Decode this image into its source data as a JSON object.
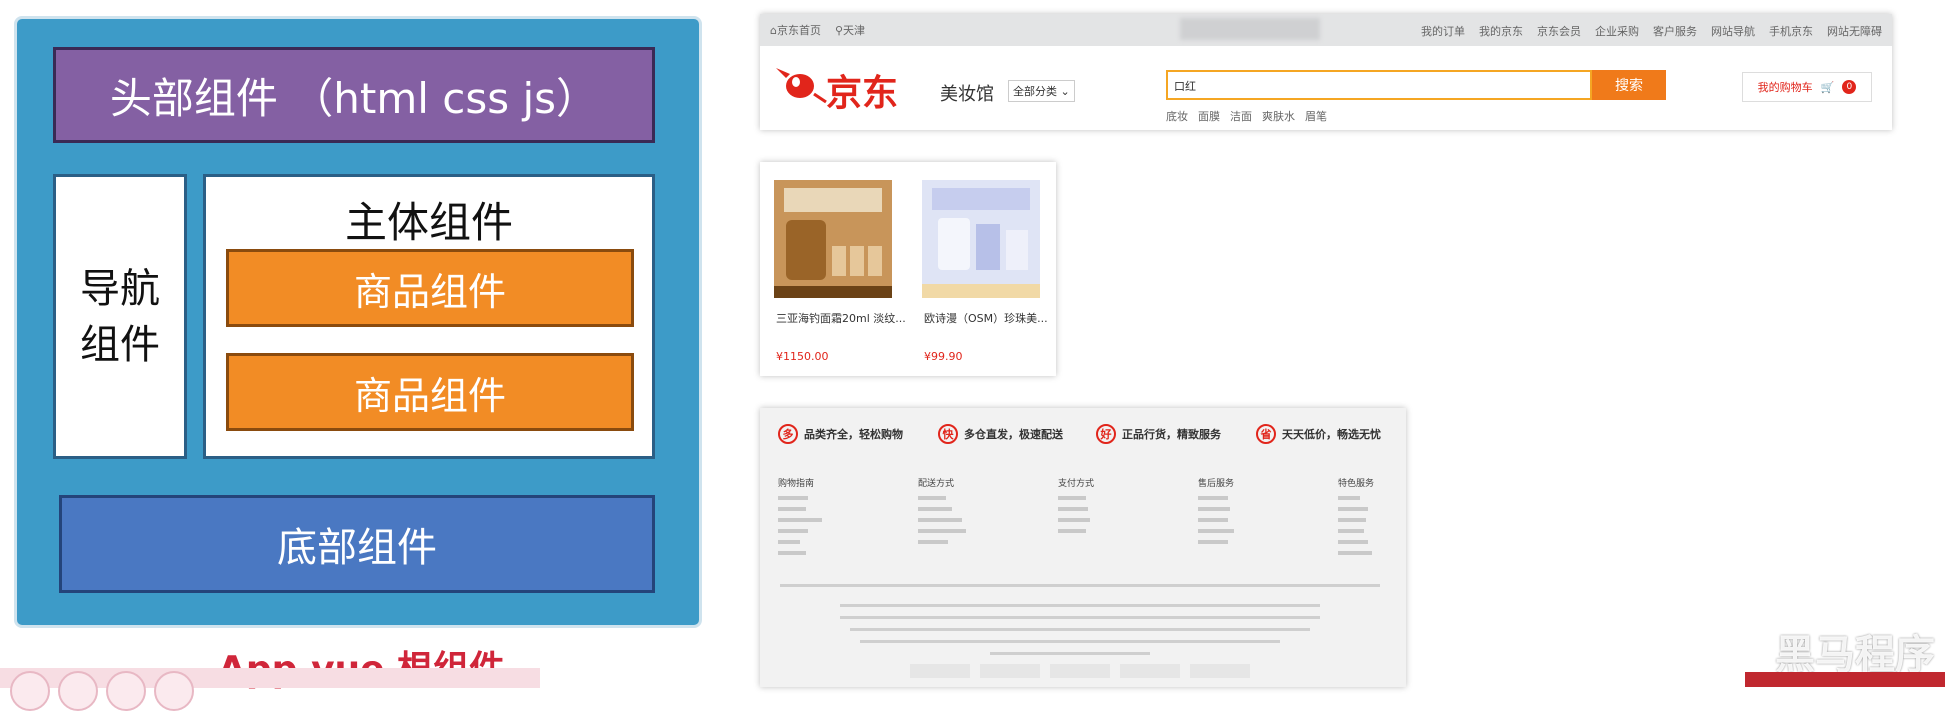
{
  "diagram": {
    "header": "头部组件 （html css js）",
    "nav_line1": "导航",
    "nav_line2": "组件",
    "main_title": "主体组件",
    "goods": [
      "商品组件",
      "商品组件"
    ],
    "footer": "底部组件",
    "root_label": "App.vue 根组件",
    "colors": {
      "frame": "#3d9bc8",
      "header": "#8460a3",
      "goods": "#f28c25",
      "footer": "#4a78c2",
      "label": "#d0263a"
    }
  },
  "jd_header": {
    "home": "京东首页",
    "location": "天津",
    "links": [
      "我的订单",
      "我的京东",
      "京东会员",
      "企业采购",
      "客户服务",
      "网站导航",
      "手机京东",
      "网站无障碍"
    ],
    "logo": "京东",
    "channel": "美妆馆",
    "category": "全部分类",
    "search_value": "口红",
    "search_button": "搜索",
    "hot_words": [
      "底妆",
      "面膜",
      "洁面",
      "爽肤水",
      "眉笔"
    ],
    "cart": "我的购物车",
    "cart_count": "0",
    "brand_color": "#e1251b"
  },
  "products": [
    {
      "title": "三亚海钓面霜20ml 淡纹...",
      "price": "¥1150.00"
    },
    {
      "title": "欧诗漫（OSM）珍珠美...",
      "price": "¥99.90"
    }
  ],
  "jd_footer": {
    "promises": [
      {
        "icon": "多",
        "text": "品类齐全，轻松购物"
      },
      {
        "icon": "快",
        "text": "多仓直发，极速配送"
      },
      {
        "icon": "好",
        "text": "正品行货，精致服务"
      },
      {
        "icon": "省",
        "text": "天天低价，畅选无忧"
      }
    ],
    "columns": [
      "购物指南",
      "配送方式",
      "支付方式",
      "售后服务",
      "特色服务"
    ]
  },
  "watermark": "黑马程序"
}
